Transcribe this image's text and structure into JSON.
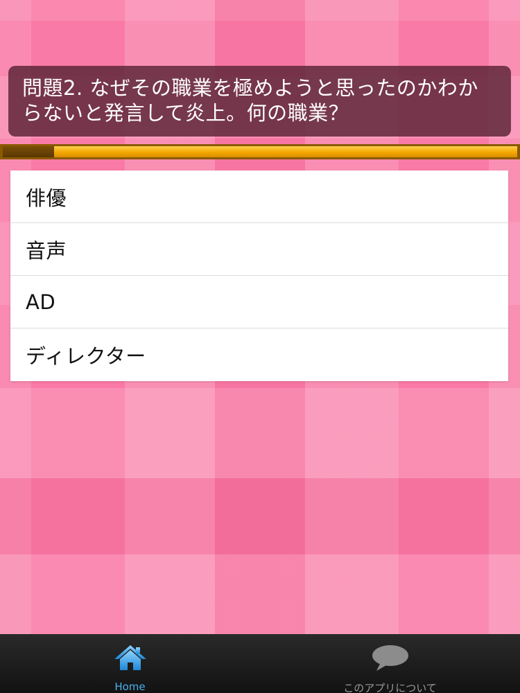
{
  "quiz": {
    "question": "問題2. なぜその職業を極めようと思ったのかわからないと発言して炎上。何の職業？",
    "progress_fraction": 0.1
  },
  "answers": [
    {
      "label": "俳優"
    },
    {
      "label": "音声"
    },
    {
      "label": "AD"
    },
    {
      "label": "ディレクター"
    }
  ],
  "tabbar": {
    "tabs": [
      {
        "label": "Home",
        "icon": "home-icon",
        "active": true
      },
      {
        "label": "このアプリについて",
        "icon": "speech-bubble-icon",
        "active": false
      }
    ]
  },
  "colors": {
    "background": "#f97aa6",
    "question_box": "#5f283a",
    "progress_fill": "#f3a800",
    "progress_done": "#5a3703",
    "tab_active": "#4ab0f0",
    "tab_inactive": "#9a9a9a"
  }
}
